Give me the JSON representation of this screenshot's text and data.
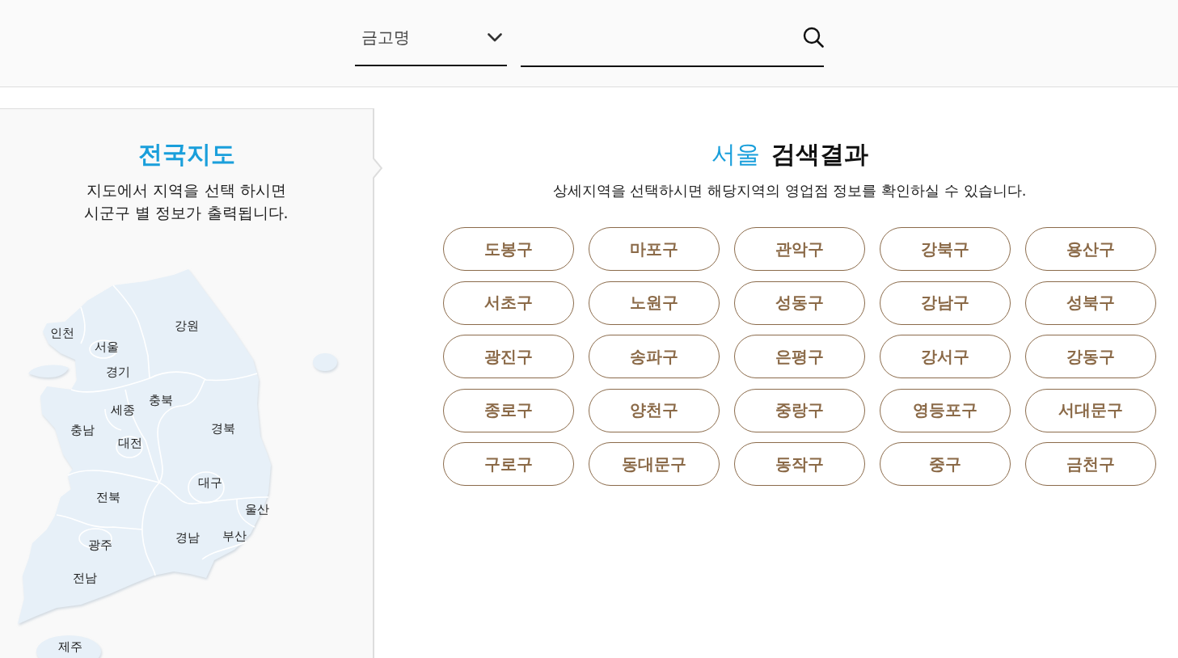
{
  "search_bar": {
    "category_select": {
      "value": "금고명"
    }
  },
  "map_panel": {
    "title": "전국지도",
    "description_lines": [
      "지도에서 지역을 선택 하시면",
      "시군구 별 정보가 출력됩니다."
    ],
    "regions": [
      {
        "label": "강원"
      },
      {
        "label": "인천"
      },
      {
        "label": "서울"
      },
      {
        "label": "경기"
      },
      {
        "label": "충북"
      },
      {
        "label": "세종"
      },
      {
        "label": "경북"
      },
      {
        "label": "충남"
      },
      {
        "label": "대전"
      },
      {
        "label": "대구"
      },
      {
        "label": "전북"
      },
      {
        "label": "울산"
      },
      {
        "label": "부산"
      },
      {
        "label": "경남"
      },
      {
        "label": "광주"
      },
      {
        "label": "전남"
      },
      {
        "label": "제주"
      }
    ]
  },
  "results": {
    "region": "서울",
    "title": "검색결과",
    "description": "상세지역을 선택하시면 해당지역의 영업점 정보를 확인하실 수 있습니다.",
    "districts": [
      {
        "label": "도봉구"
      },
      {
        "label": "마포구"
      },
      {
        "label": "관악구"
      },
      {
        "label": "강북구"
      },
      {
        "label": "용산구"
      },
      {
        "label": "서초구"
      },
      {
        "label": "노원구"
      },
      {
        "label": "성동구"
      },
      {
        "label": "강남구"
      },
      {
        "label": "성북구"
      },
      {
        "label": "광진구"
      },
      {
        "label": "송파구"
      },
      {
        "label": "은평구"
      },
      {
        "label": "강서구"
      },
      {
        "label": "강동구"
      },
      {
        "label": "종로구"
      },
      {
        "label": "양천구"
      },
      {
        "label": "중랑구"
      },
      {
        "label": "영등포구"
      },
      {
        "label": "서대문구"
      },
      {
        "label": "구로구"
      },
      {
        "label": "동대문구"
      },
      {
        "label": "동작구"
      },
      {
        "label": "중구"
      },
      {
        "label": "금천구"
      }
    ]
  }
}
